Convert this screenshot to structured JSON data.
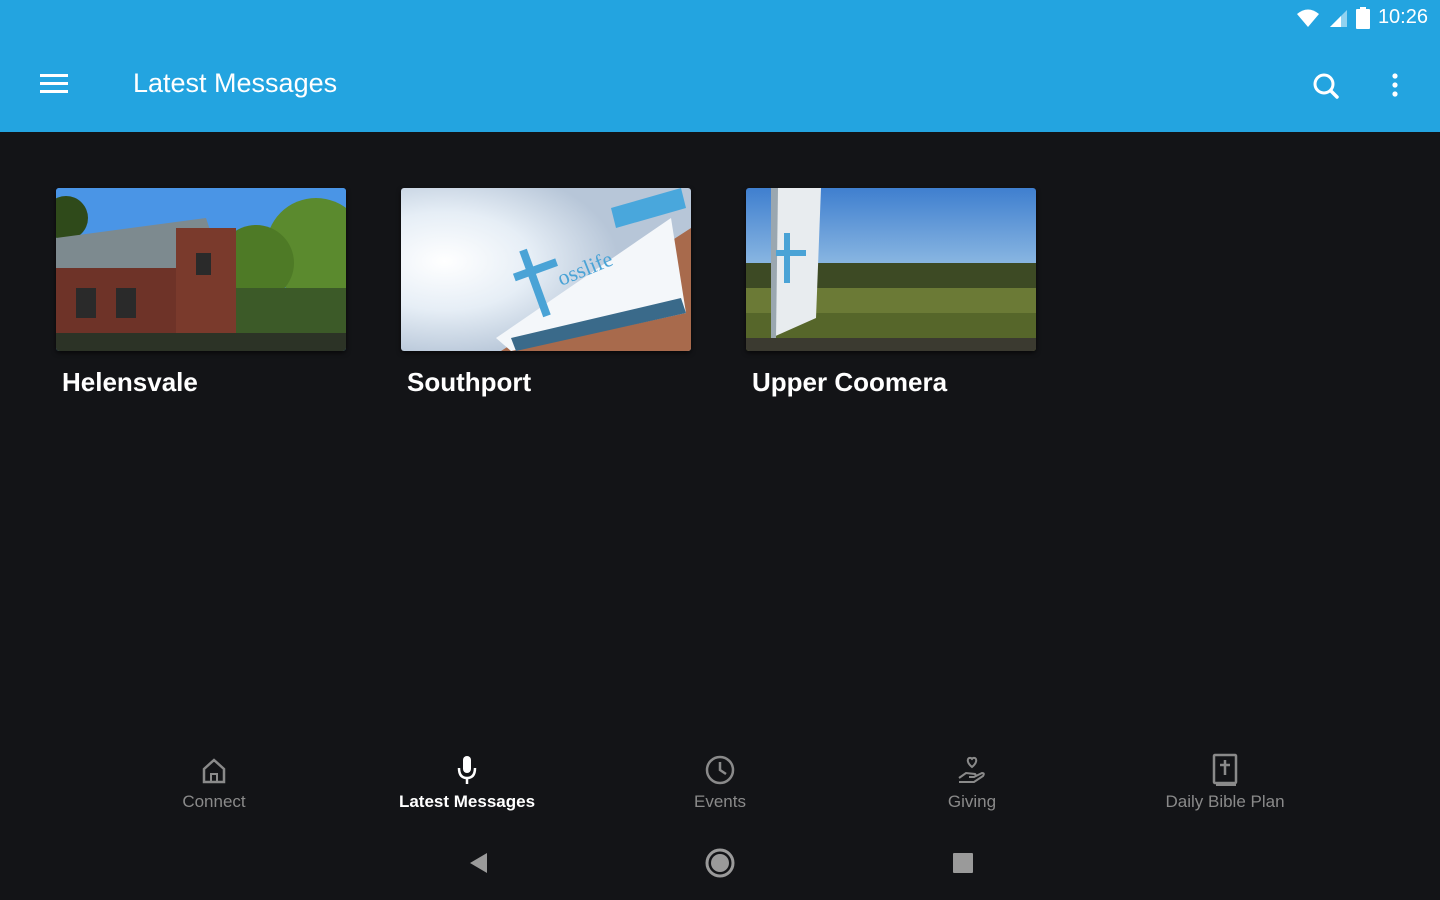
{
  "status_bar": {
    "time": "10:26"
  },
  "app_bar": {
    "title": "Latest Messages"
  },
  "locations": [
    {
      "name": "Helensvale"
    },
    {
      "name": "Southport"
    },
    {
      "name": "Upper Coomera"
    }
  ],
  "bottom_nav": {
    "items": [
      {
        "label": "Connect",
        "icon": "home-icon"
      },
      {
        "label": "Latest Messages",
        "icon": "microphone-icon",
        "active": true
      },
      {
        "label": "Events",
        "icon": "clock-icon"
      },
      {
        "label": "Giving",
        "icon": "giving-hand-icon"
      },
      {
        "label": "Daily Bible Plan",
        "icon": "bible-icon"
      }
    ]
  },
  "colors": {
    "accent": "#23a4e0",
    "background": "#131417"
  }
}
